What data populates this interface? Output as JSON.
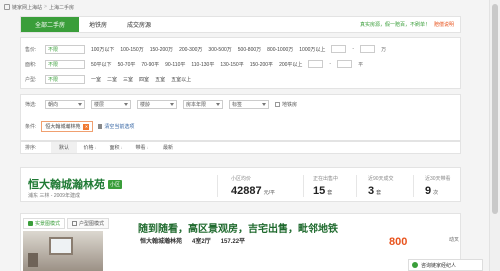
{
  "breadcrumb": {
    "items": [
      "链家网上海站",
      "上海二手房"
    ]
  },
  "tabs": [
    {
      "label": "全部二手房",
      "active": true
    },
    {
      "label": "地铁房",
      "active": false
    },
    {
      "label": "成交房源",
      "active": false
    }
  ],
  "promo": {
    "text": "真实房源，假一赔百，不刷单！",
    "cta": "赔偿说明"
  },
  "filters": {
    "price": {
      "label": "售价:",
      "options": [
        "不限",
        "100万以下",
        "100-150万",
        "150-200万",
        "200-300万",
        "300-500万",
        "500-800万",
        "800-1000万",
        "1000万以上"
      ],
      "unit": "万",
      "sep": "-"
    },
    "area": {
      "label": "面积:",
      "options": [
        "不限",
        "50平以下",
        "50-70平",
        "70-90平",
        "90-110平",
        "110-130平",
        "130-150平",
        "150-200平",
        "200平以上"
      ],
      "unit": "平",
      "sep": "-"
    },
    "layout": {
      "label": "户型:",
      "options": [
        "不限",
        "一室",
        "二室",
        "三室",
        "四室",
        "五室",
        "五室以上"
      ]
    }
  },
  "more_filters": {
    "label": "筛选:",
    "selects": [
      "朝向",
      "楼层",
      "楼龄",
      "房本年限",
      "标签"
    ],
    "checkbox": "地铁房"
  },
  "conditions": {
    "label": "条件:",
    "tag": "恒大翰城瀚林苑",
    "clear": "清空当前选项"
  },
  "sort": {
    "label": "排序:",
    "items": [
      "默认",
      "价格",
      "面积",
      "带看",
      "最新"
    ],
    "arrow": "↓"
  },
  "community": {
    "name": "恒大翰城瀚林苑",
    "badge": "小区",
    "sub": "浦东 三林 - 2009年建成",
    "avg_price_label": "小区均价",
    "avg_price": "42887",
    "avg_price_unit": "元/平",
    "on_sale_label": "正在出售中",
    "on_sale": "15",
    "on_sale_unit": "套",
    "deals_label": "近90天成交",
    "deals": "3",
    "deals_unit": "套",
    "visits_label": "近30天带看",
    "visits": "9",
    "visits_unit": "次"
  },
  "listing": {
    "tab_photo": "实景图模式",
    "tab_plan": "户型图模式",
    "title": "随到随看，高区景观房，吉宅出售，毗邻地铁",
    "community": "恒大翰城瀚林苑",
    "layout": "4室2厅",
    "area": "157.22平",
    "price": "800",
    "extra": "动叉"
  },
  "chat": {
    "label": "咨询链家经纪人"
  }
}
